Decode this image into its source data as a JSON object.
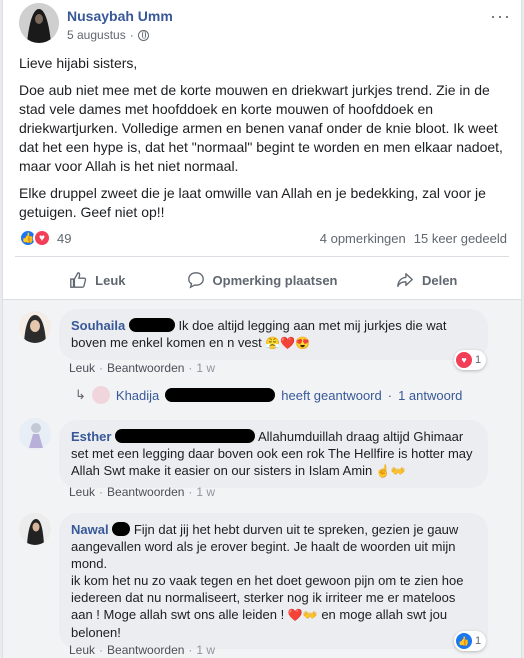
{
  "post": {
    "author": "Nusaybah Umm",
    "date": "5 augustus",
    "dot": "·",
    "more_icon": "···",
    "paragraphs": [
      "Lieve hijabi sisters,",
      "Doe aub niet mee met de korte mouwen en driekwart jurkjes trend. Zie in de stad vele dames met hoofddoek en korte mouwen of hoofddoek en driekwartjurken. Volledige armen en benen vanaf onder de knie bloot. Ik weet dat het een hype is, dat het \"normaal\" begint te worden en men elkaar nadoet, maar voor Allah is het niet normaal.",
      "Elke druppel zweet die je laat omwille van Allah en je bedekking, zal voor je getuigen. Geef niet op!!"
    ],
    "reaction_count": "49",
    "comments_count": "4 opmerkingen",
    "shares_count": "15 keer gedeeld"
  },
  "actions": {
    "like": "Leuk",
    "comment": "Opmerking plaatsen",
    "share": "Delen"
  },
  "comments": [
    {
      "name": "Souhaila",
      "text": "Ik doe altijd legging aan met mij jurkjes die wat boven me enkel komen en n vest",
      "emojis": "😤❤️😍",
      "like": "Leuk",
      "reply": "Beantwoorden",
      "time": "1 w",
      "reaction_count": "1"
    },
    {
      "name": "Esther",
      "text": "Allahumduillah draag altijd Ghimaar set met een legging daar boven ook een rok The Hellfire is hotter may Allah Swt make it easier on our sisters in Islam Amin",
      "emojis": "☝️👐",
      "like": "Leuk",
      "reply": "Beantwoorden",
      "time": "1 w"
    },
    {
      "name": "Nawal",
      "text_1": "Fijn dat jij het hebt durven uit te spreken, gezien je gauw aangevallen word als je erover begint. Je haalt de woorden uit mijn mond.",
      "text_2": "ik kom het nu zo vaak tegen en het doet gewoon pijn om te zien hoe iedereen dat nu normaliseert, sterker nog ik irriteer me er mateloos aan ! Moge allah swt ons alle leiden !",
      "text_3": "en moge allah swt jou belonen!",
      "emoji_mid": "❤️👐",
      "like": "Leuk",
      "reply": "Beantwoorden",
      "time": "1 w",
      "reaction_count": "1"
    }
  ],
  "reply_summary": {
    "arrow": "↳",
    "name": "Khadija",
    "text": "heeft geantwoord",
    "dot": "·",
    "count": "1 antwoord"
  },
  "colors": {
    "link": "#385898",
    "like_blue": "#1877f2",
    "love_red": "#f33e58"
  }
}
